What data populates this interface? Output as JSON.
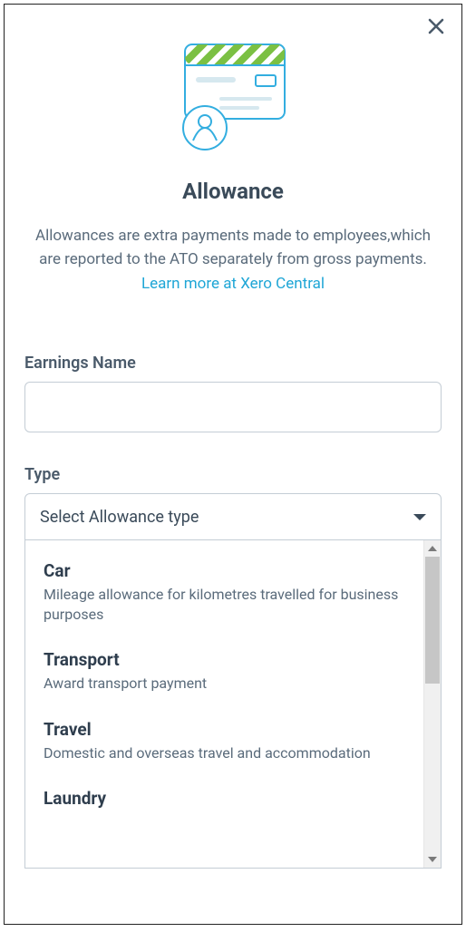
{
  "modal": {
    "title": "Allowance",
    "description_prefix": "Allowances are extra payments made to employees,which are reported to the ATO separately from gross payments. ",
    "learn_more": "Learn more at Xero Central"
  },
  "fields": {
    "earnings_name": {
      "label": "Earnings Name",
      "value": ""
    },
    "type": {
      "label": "Type",
      "placeholder": "Select Allowance type",
      "options": [
        {
          "title": "Car",
          "desc": "Mileage allowance for kilometres travelled for business purposes"
        },
        {
          "title": "Transport",
          "desc": "Award transport payment"
        },
        {
          "title": "Travel",
          "desc": "Domestic and overseas travel and accommodation"
        },
        {
          "title": "Laundry",
          "desc": ""
        }
      ]
    }
  }
}
